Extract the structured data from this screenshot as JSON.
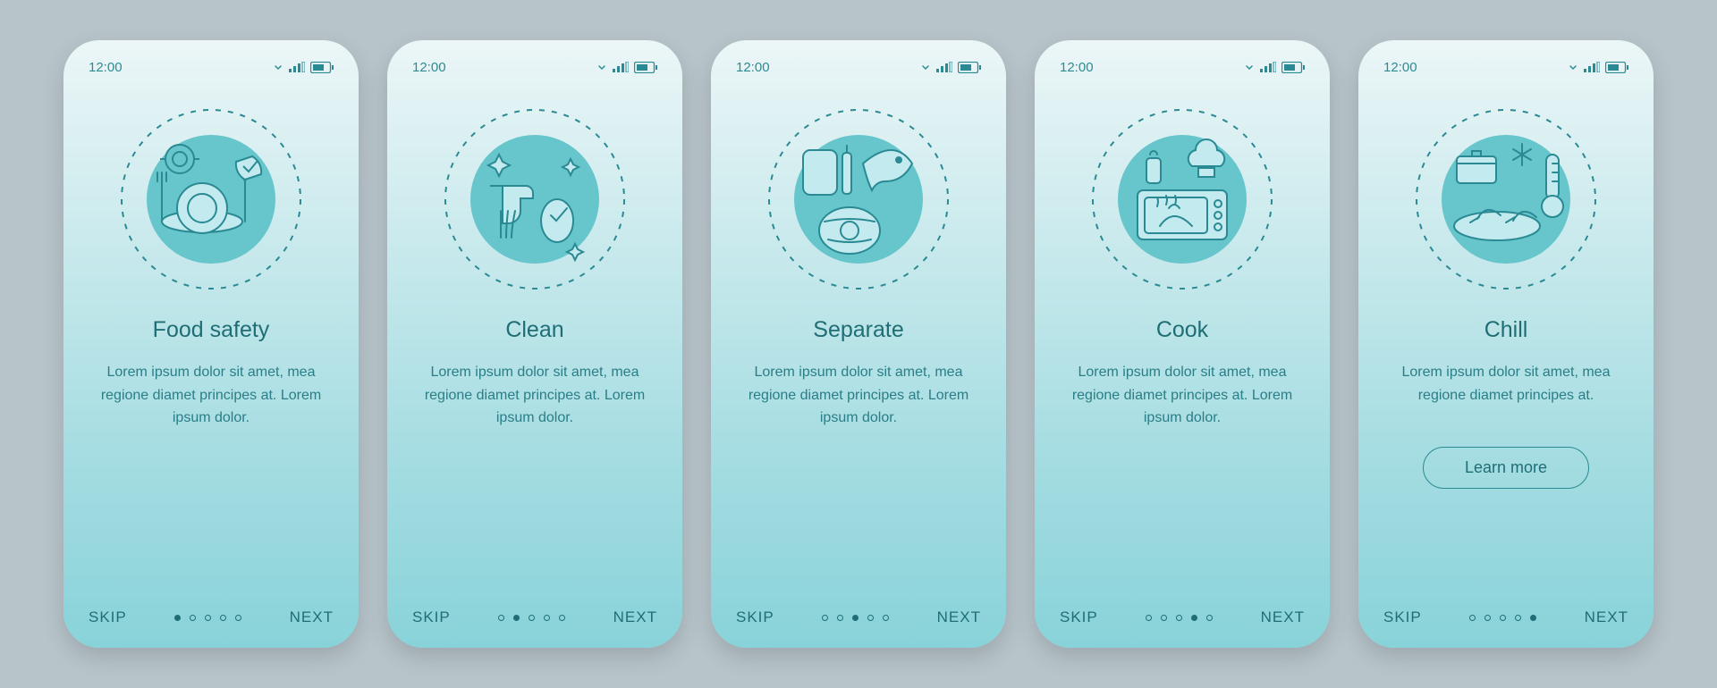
{
  "status": {
    "time": "12:00",
    "icons": [
      "chevron-icon",
      "signal-icon",
      "battery-icon"
    ]
  },
  "screens": [
    {
      "icon_name": "food-safety-icon",
      "title": "Food safety",
      "desc": "Lorem ipsum dolor sit amet, mea regione diamet principes at. Lorem ipsum dolor.",
      "skip": "SKIP",
      "next": "NEXT",
      "total_dots": 5,
      "active_dot": 0,
      "cta": null
    },
    {
      "icon_name": "clean-icon",
      "title": "Clean",
      "desc": "Lorem ipsum dolor sit amet, mea regione diamet principes at. Lorem ipsum dolor.",
      "skip": "SKIP",
      "next": "NEXT",
      "total_dots": 5,
      "active_dot": 1,
      "cta": null
    },
    {
      "icon_name": "separate-icon",
      "title": "Separate",
      "desc": "Lorem ipsum dolor sit amet, mea regione diamet principes at. Lorem ipsum dolor.",
      "skip": "SKIP",
      "next": "NEXT",
      "total_dots": 5,
      "active_dot": 2,
      "cta": null
    },
    {
      "icon_name": "cook-icon",
      "title": "Cook",
      "desc": "Lorem ipsum dolor sit amet, mea regione diamet principes at. Lorem ipsum dolor.",
      "skip": "SKIP",
      "next": "NEXT",
      "total_dots": 5,
      "active_dot": 3,
      "cta": null
    },
    {
      "icon_name": "chill-icon",
      "title": "Chill",
      "desc": "Lorem ipsum dolor sit amet, mea regione diamet principes at.",
      "skip": "SKIP",
      "next": "NEXT",
      "total_dots": 5,
      "active_dot": 4,
      "cta": "Learn more"
    }
  ],
  "colors": {
    "stroke": "#2a8a93",
    "fill": "#67c5cc",
    "light": "#c3eaee"
  }
}
